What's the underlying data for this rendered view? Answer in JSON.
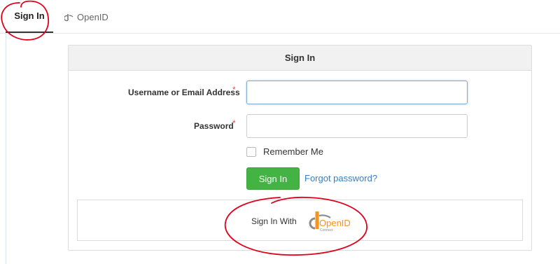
{
  "tabs": [
    {
      "label": "Sign In",
      "icon": null
    },
    {
      "label": "OpenID",
      "icon": "openid-icon"
    }
  ],
  "panel": {
    "title": "Sign In",
    "username_label": "Username or Email Address",
    "password_label": "Password",
    "required_mark": "*",
    "username_value": "",
    "password_value": "",
    "remember_label": "Remember Me",
    "remember_checked": false,
    "signin_button": "Sign In",
    "forgot_link": "Forgot password?",
    "openid_prompt": "Sign In With",
    "openid_logo_text": "OpenID",
    "openid_logo_subtext": "Connect"
  },
  "colors": {
    "primary_button": "#43b343",
    "link": "#3a7fc0",
    "required": "#d9534f",
    "annotation": "#e0001b",
    "openid_orange": "#f7931e"
  }
}
